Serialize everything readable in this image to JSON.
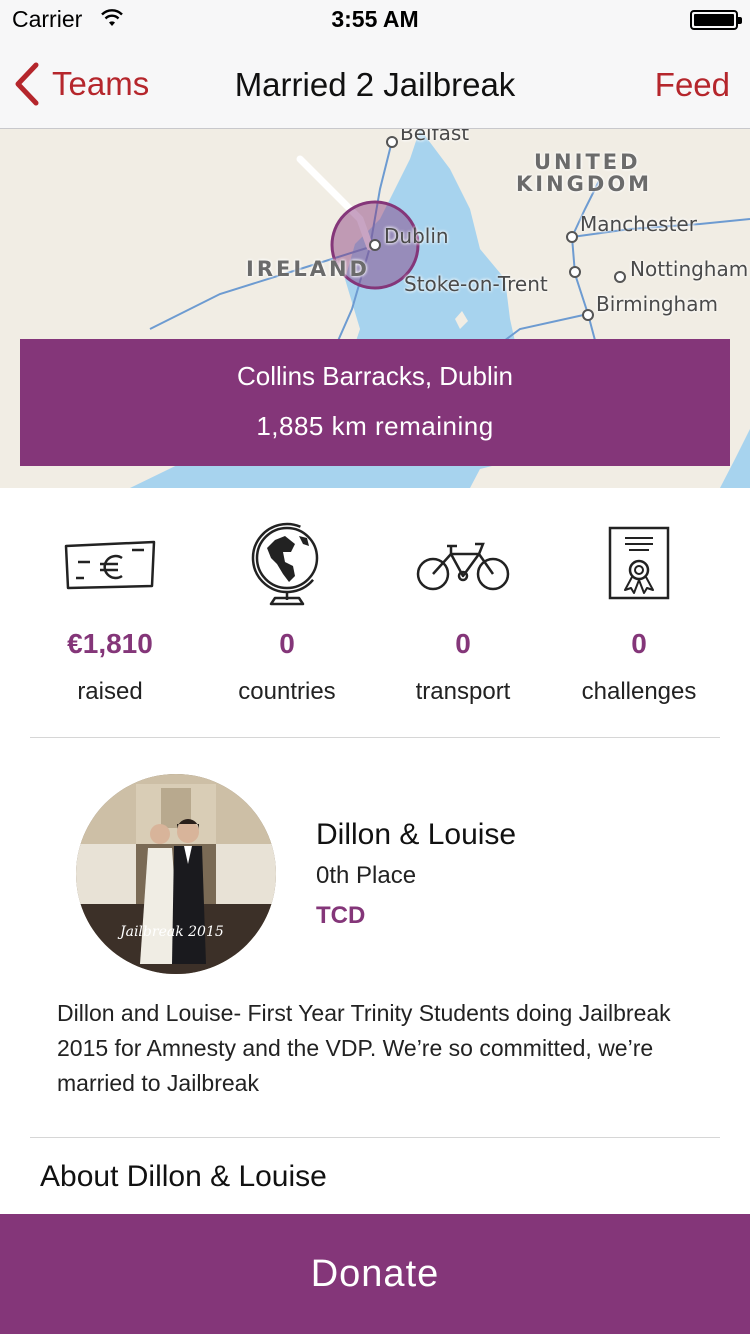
{
  "status_bar": {
    "carrier": "Carrier",
    "time": "3:55 AM",
    "wifi_icon": "wifi-icon",
    "battery_icon": "battery-icon"
  },
  "nav": {
    "back_label": "Teams",
    "title": "Married 2 Jailbreak",
    "feed_label": "Feed",
    "accent_color": "#b5262c"
  },
  "map": {
    "countries": [
      "UNITED KINGDOM",
      "IRELAND"
    ],
    "country_lines": {
      "uk_1": "UNITED",
      "uk_2": "KINGDOM",
      "ireland": "IRELAND"
    },
    "cities": {
      "belfast": "Belfast",
      "dublin": "Dublin",
      "manchester": "Manchester",
      "nottingham": "Nottingham",
      "stoke": "Stoke-on-Trent",
      "birmingham": "Birmingham"
    }
  },
  "location": {
    "name": "Collins Barracks, Dublin",
    "remaining": "1,885 km remaining"
  },
  "stats": [
    {
      "icon": "banknote-icon",
      "value": "€1,810",
      "label": "raised"
    },
    {
      "icon": "globe-icon",
      "value": "0",
      "label": "countries"
    },
    {
      "icon": "bicycle-icon",
      "value": "0",
      "label": "transport"
    },
    {
      "icon": "certificate-icon",
      "value": "0",
      "label": "challenges"
    }
  ],
  "team": {
    "name": "Dillon & Louise",
    "place": "0th Place",
    "school": "TCD",
    "photo_caption": "Jailbreak 2015",
    "bio": "Dillon and Louise- First Year Trinity Students doing Jailbreak 2015 for Amnesty and the VDP. We’re so committed, we’re married to Jailbreak"
  },
  "about": {
    "title": "About Dillon & Louise"
  },
  "donate": {
    "label": "Donate"
  },
  "colors": {
    "brand_purple": "#843679",
    "nav_red": "#b5262c"
  }
}
